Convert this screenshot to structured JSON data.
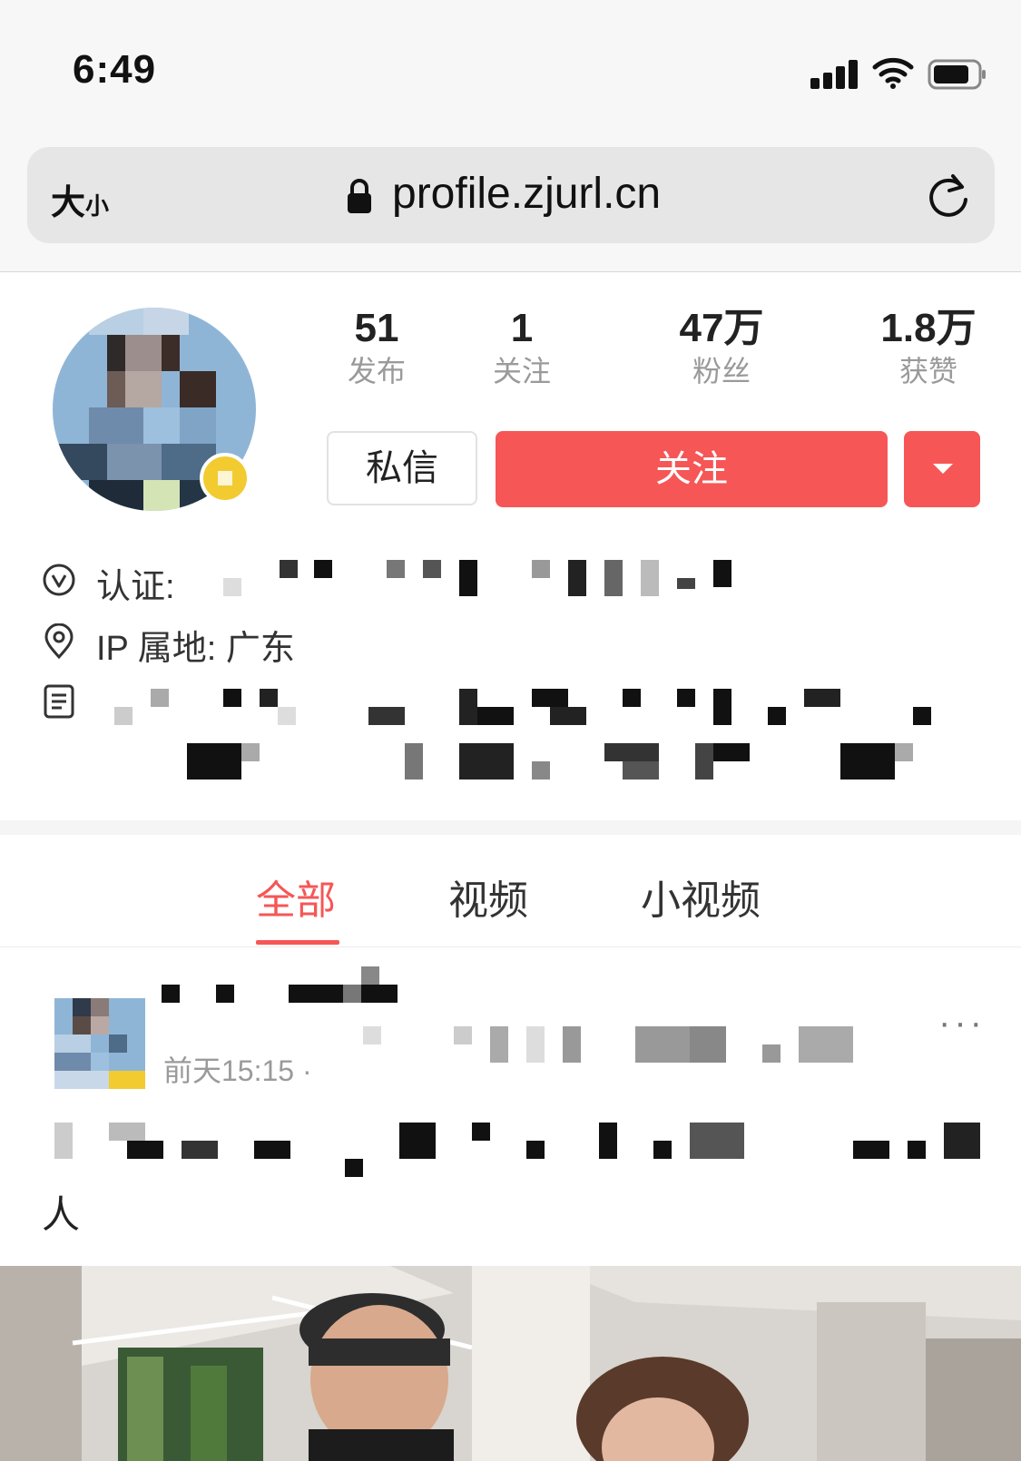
{
  "status_bar": {
    "time": "6:49",
    "icons": [
      "cellular-signal-icon",
      "wifi-icon",
      "battery-icon"
    ]
  },
  "browser": {
    "text_size_label": "大",
    "text_size_small": "小",
    "url": "profile.zjurl.cn",
    "icons": [
      "lock-icon",
      "reload-icon"
    ]
  },
  "profile": {
    "stats": [
      {
        "value": "51",
        "label": "发布"
      },
      {
        "value": "1",
        "label": "关注"
      },
      {
        "value": "47万",
        "label": "粉丝"
      },
      {
        "value": "1.8万",
        "label": "获赞"
      }
    ],
    "message_button": "私信",
    "follow_button": "关注",
    "verification_label": "认证:",
    "ip_location": "IP 属地: 广东"
  },
  "tabs": [
    {
      "label": "全部",
      "active": true
    },
    {
      "label": "视频",
      "active": false
    },
    {
      "label": "小视频",
      "active": false
    }
  ],
  "post": {
    "time": "前天15:15 ·",
    "more": "···",
    "text_tail": "人"
  },
  "colors": {
    "accent": "#f65656",
    "muted_text": "#9a9a9a",
    "background": "#f7f7f7"
  }
}
